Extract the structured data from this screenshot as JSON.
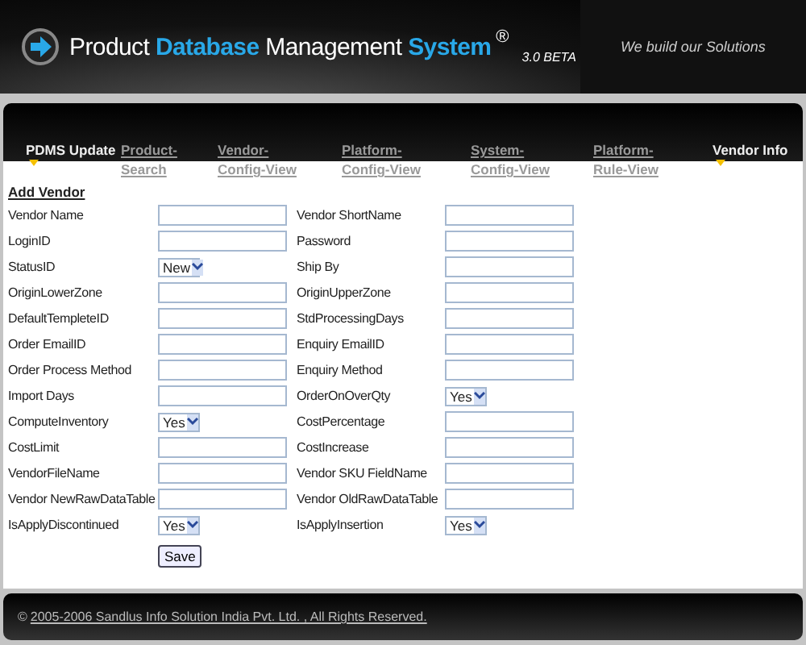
{
  "header": {
    "title_parts": [
      {
        "text": "Product ",
        "accent": false
      },
      {
        "text": "Database",
        "accent": true
      },
      {
        "text": " Management ",
        "accent": false
      },
      {
        "text": "System",
        "accent": true
      }
    ],
    "registered": "®",
    "version": "3.0 BETA",
    "tagline": "We build our Solutions"
  },
  "nav": [
    {
      "lines": [
        "PDMS Update"
      ],
      "marked": true
    },
    {
      "lines": [
        "Product-",
        "Search"
      ],
      "marked": false
    },
    {
      "lines": [
        "Vendor-",
        "Config-View"
      ],
      "marked": false
    },
    {
      "lines": [
        "Platform-",
        "Config-View"
      ],
      "marked": false
    },
    {
      "lines": [
        "System-",
        "Config-View"
      ],
      "marked": false
    },
    {
      "lines": [
        "Platform-",
        "Rule-View"
      ],
      "marked": false
    },
    {
      "lines": [
        "Vendor Info"
      ],
      "marked": true
    }
  ],
  "form": {
    "title": "Add Vendor",
    "rows": [
      [
        {
          "label": "Vendor Name",
          "kind": "text"
        },
        {
          "label": "Vendor ShortName",
          "kind": "text"
        }
      ],
      [
        {
          "label": "LoginID",
          "kind": "text"
        },
        {
          "label": "Password",
          "kind": "text"
        }
      ],
      [
        {
          "label": "StatusID",
          "kind": "select",
          "value": "New"
        },
        {
          "label": "Ship By",
          "kind": "text"
        }
      ],
      [
        {
          "label": "OriginLowerZone",
          "kind": "text"
        },
        {
          "label": "OriginUpperZone",
          "kind": "text"
        }
      ],
      [
        {
          "label": "DefaultTempleteID",
          "kind": "text"
        },
        {
          "label": "StdProcessingDays",
          "kind": "text"
        }
      ],
      [
        {
          "label": "Order EmailID",
          "kind": "text"
        },
        {
          "label": "Enquiry EmailID",
          "kind": "text"
        }
      ],
      [
        {
          "label": "Order Process Method",
          "kind": "text"
        },
        {
          "label": "Enquiry Method",
          "kind": "text"
        }
      ],
      [
        {
          "label": "Import Days",
          "kind": "text"
        },
        {
          "label": "OrderOnOverQty",
          "kind": "select",
          "value": "Yes"
        }
      ],
      [
        {
          "label": "ComputeInventory",
          "kind": "select",
          "value": "Yes"
        },
        {
          "label": "CostPercentage",
          "kind": "text"
        }
      ],
      [
        {
          "label": "CostLimit",
          "kind": "text"
        },
        {
          "label": "CostIncrease",
          "kind": "text"
        }
      ],
      [
        {
          "label": "VendorFileName",
          "kind": "text"
        },
        {
          "label": "Vendor SKU FieldName",
          "kind": "text"
        }
      ],
      [
        {
          "label": "Vendor NewRawDataTable",
          "kind": "text"
        },
        {
          "label": "Vendor OldRawDataTable",
          "kind": "text"
        }
      ],
      [
        {
          "label": "IsApplyDiscontinued",
          "kind": "select",
          "value": "Yes"
        },
        {
          "label": "IsApplyInsertion",
          "kind": "select",
          "value": "Yes"
        }
      ]
    ],
    "save": "Save"
  },
  "footer": {
    "copyright": "©",
    "link": "2005-2006 Sandlus Info Solution India Pvt. Ltd. , All Rights Reserved."
  }
}
